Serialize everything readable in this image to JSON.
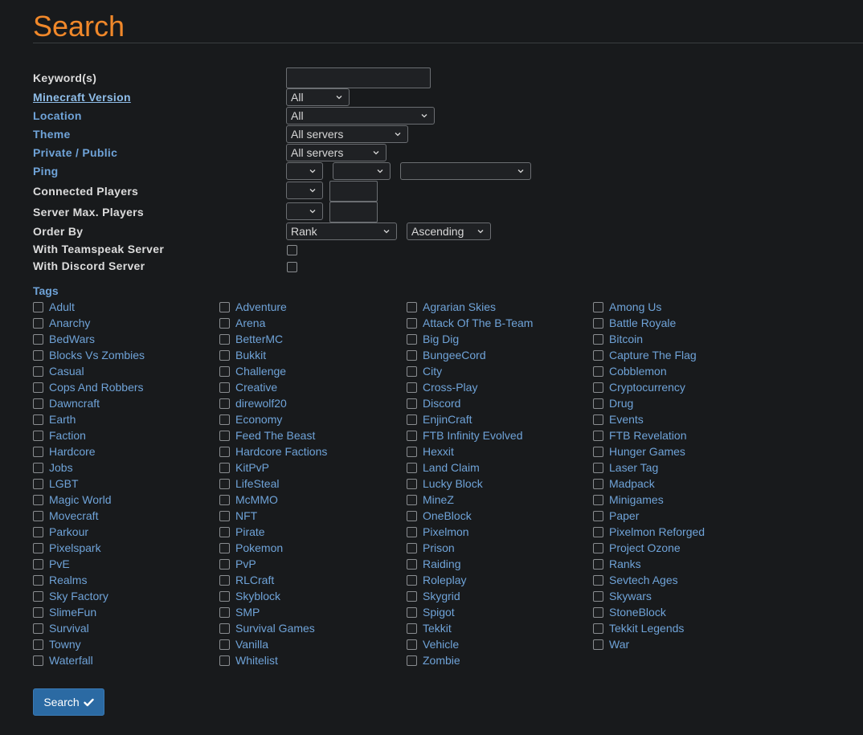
{
  "page": {
    "title": "Search"
  },
  "form": {
    "keywords": {
      "label": "Keyword(s)",
      "value": ""
    },
    "minecraft_version": {
      "label": "Minecraft Version",
      "value": "All"
    },
    "location": {
      "label": "Location",
      "value": "All"
    },
    "theme": {
      "label": "Theme",
      "value": "All servers"
    },
    "private_public": {
      "label": "Private / Public",
      "value": "All servers"
    },
    "ping": {
      "label": "Ping",
      "select1": "",
      "select2": "",
      "select3": ""
    },
    "connected_players": {
      "label": "Connected Players",
      "operator": "",
      "value": ""
    },
    "server_max_players": {
      "label": "Server Max. Players",
      "operator": "",
      "value": ""
    },
    "order_by": {
      "label": "Order By",
      "field": "Rank",
      "direction": "Ascending"
    },
    "teamspeak": {
      "label": "With Teamspeak Server",
      "checked": false
    },
    "discord": {
      "label": "With Discord Server",
      "checked": false
    }
  },
  "tags": {
    "heading": "Tags",
    "columns": [
      [
        "Adult",
        "Anarchy",
        "BedWars",
        "Blocks Vs Zombies",
        "Casual",
        "Cops And Robbers",
        "Dawncraft",
        "Earth",
        "Faction",
        "Hardcore",
        "Jobs",
        "LGBT",
        "Magic World",
        "Movecraft",
        "Parkour",
        "Pixelspark",
        "PvE",
        "Realms",
        "Sky Factory",
        "SlimeFun",
        "Survival",
        "Towny",
        "Waterfall"
      ],
      [
        "Adventure",
        "Arena",
        "BetterMC",
        "Bukkit",
        "Challenge",
        "Creative",
        "direwolf20",
        "Economy",
        "Feed The Beast",
        "Hardcore Factions",
        "KitPvP",
        "LifeSteal",
        "McMMO",
        "NFT",
        "Pirate",
        "Pokemon",
        "PvP",
        "RLCraft",
        "Skyblock",
        "SMP",
        "Survival Games",
        "Vanilla",
        "Whitelist"
      ],
      [
        "Agrarian Skies",
        "Attack Of The B-Team",
        "Big Dig",
        "BungeeCord",
        "City",
        "Cross-Play",
        "Discord",
        "EnjinCraft",
        "FTB Infinity Evolved",
        "Hexxit",
        "Land Claim",
        "Lucky Block",
        "MineZ",
        "OneBlock",
        "Pixelmon",
        "Prison",
        "Raiding",
        "Roleplay",
        "Skygrid",
        "Spigot",
        "Tekkit",
        "Vehicle",
        "Zombie"
      ],
      [
        "Among Us",
        "Battle Royale",
        "Bitcoin",
        "Capture The Flag",
        "Cobblemon",
        "Cryptocurrency",
        "Drug",
        "Events",
        "FTB Revelation",
        "Hunger Games",
        "Laser Tag",
        "Madpack",
        "Minigames",
        "Paper",
        "Pixelmon Reforged",
        "Project Ozone",
        "Ranks",
        "Sevtech Ages",
        "Skywars",
        "StoneBlock",
        "Tekkit Legends",
        "War"
      ]
    ]
  },
  "search_button": {
    "label": "Search",
    "icon": "check-icon"
  },
  "colors": {
    "background": "#181a1c",
    "title": "#f0882a",
    "link": "#6fa3d8",
    "button": "#2b6aa3"
  }
}
